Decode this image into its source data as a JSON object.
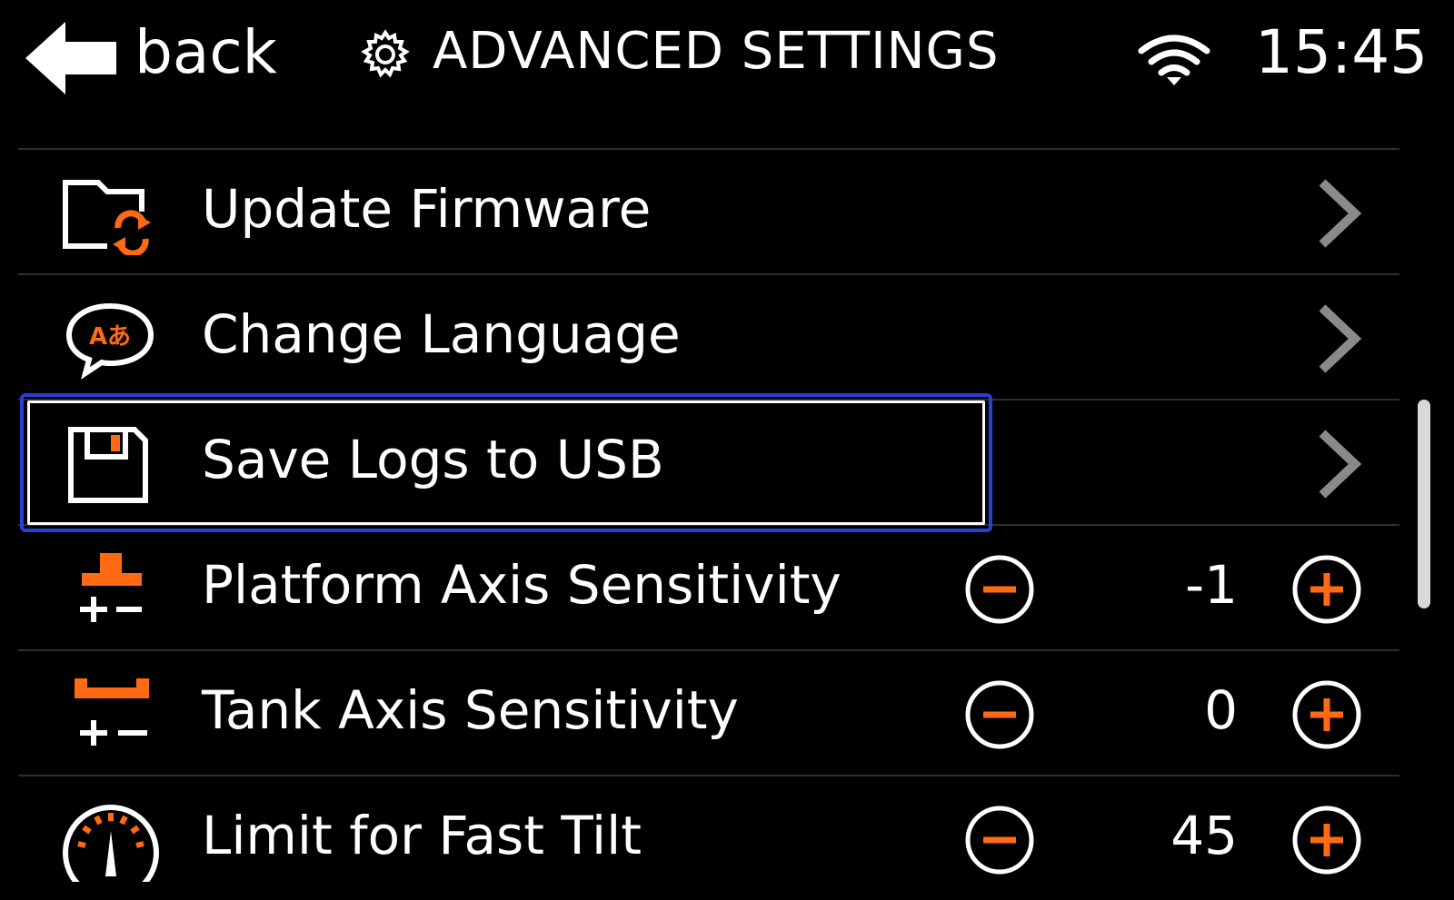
{
  "header": {
    "back_label": "back",
    "title": "ADVANCED SETTINGS",
    "time": "15:45",
    "icons": {
      "back": "back-arrow-icon",
      "title": "gear-icon",
      "status": "wifi-icon"
    }
  },
  "colors": {
    "accent": "#ff6a13",
    "background": "#000000",
    "text": "#ffffff",
    "focus": "#2a3fd6",
    "chevron": "#8a8a8a"
  },
  "menu": {
    "items": [
      {
        "label": "Update Firmware",
        "icon": "folder-sync-icon",
        "type": "link"
      },
      {
        "label": "Change Language",
        "icon": "language-bubble-icon",
        "type": "link"
      },
      {
        "label": "Save Logs to USB",
        "icon": "floppy-disk-icon",
        "type": "link",
        "focused": true
      },
      {
        "label": "Platform Axis Sensitivity",
        "icon": "platform-axis-icon",
        "type": "stepper",
        "value": "-1"
      },
      {
        "label": "Tank Axis Sensitivity",
        "icon": "tank-axis-icon",
        "type": "stepper",
        "value": "0"
      },
      {
        "label": "Limit for Fast Tilt",
        "icon": "gauge-icon",
        "type": "stepper",
        "value": "45"
      }
    ]
  }
}
